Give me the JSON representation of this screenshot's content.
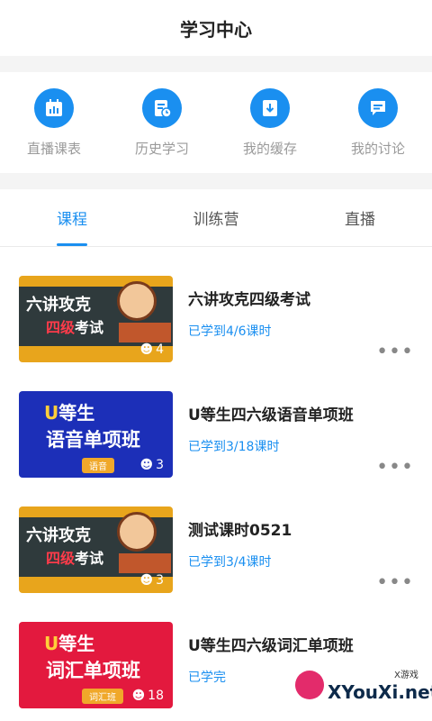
{
  "header": {
    "title": "学习中心"
  },
  "shortcuts": [
    {
      "label": "直播课表",
      "icon": "calendar-chart-icon"
    },
    {
      "label": "历史学习",
      "icon": "history-doc-icon"
    },
    {
      "label": "我的缓存",
      "icon": "download-icon"
    },
    {
      "label": "我的讨论",
      "icon": "comment-icon"
    }
  ],
  "tabs": [
    {
      "label": "课程",
      "active": true
    },
    {
      "label": "训练营",
      "active": false
    },
    {
      "label": "直播",
      "active": false
    }
  ],
  "courses": [
    {
      "name": "六讲攻克四级考试",
      "progress": "已学到4/6课时",
      "thumb": {
        "style": "gold",
        "line1": "六讲攻克",
        "line2_red": "四级",
        "line2": "考试",
        "count": "4"
      }
    },
    {
      "name": "U等生四六级语音单项班",
      "progress": "已学到3/18课时",
      "thumb": {
        "style": "blue",
        "logo_u": "U",
        "logo": "等生",
        "big": "语音单项班",
        "tag": "语音",
        "count": "3"
      }
    },
    {
      "name": "测试课时0521",
      "progress": "已学到3/4课时",
      "thumb": {
        "style": "gold",
        "line1": "六讲攻克",
        "line2_red": "四级",
        "line2": "考试",
        "count": "3"
      }
    },
    {
      "name": "U等生四六级词汇单项班",
      "progress": "已学完",
      "thumb": {
        "style": "red",
        "logo_u": "U",
        "logo": "等生",
        "big": "词汇单项班",
        "tag": "词汇班",
        "count": "18"
      }
    }
  ],
  "more_label": "•••",
  "watermark": {
    "text": "XYouXi.net",
    "small": "X游戏"
  },
  "colors": {
    "accent": "#1a8ff0"
  }
}
